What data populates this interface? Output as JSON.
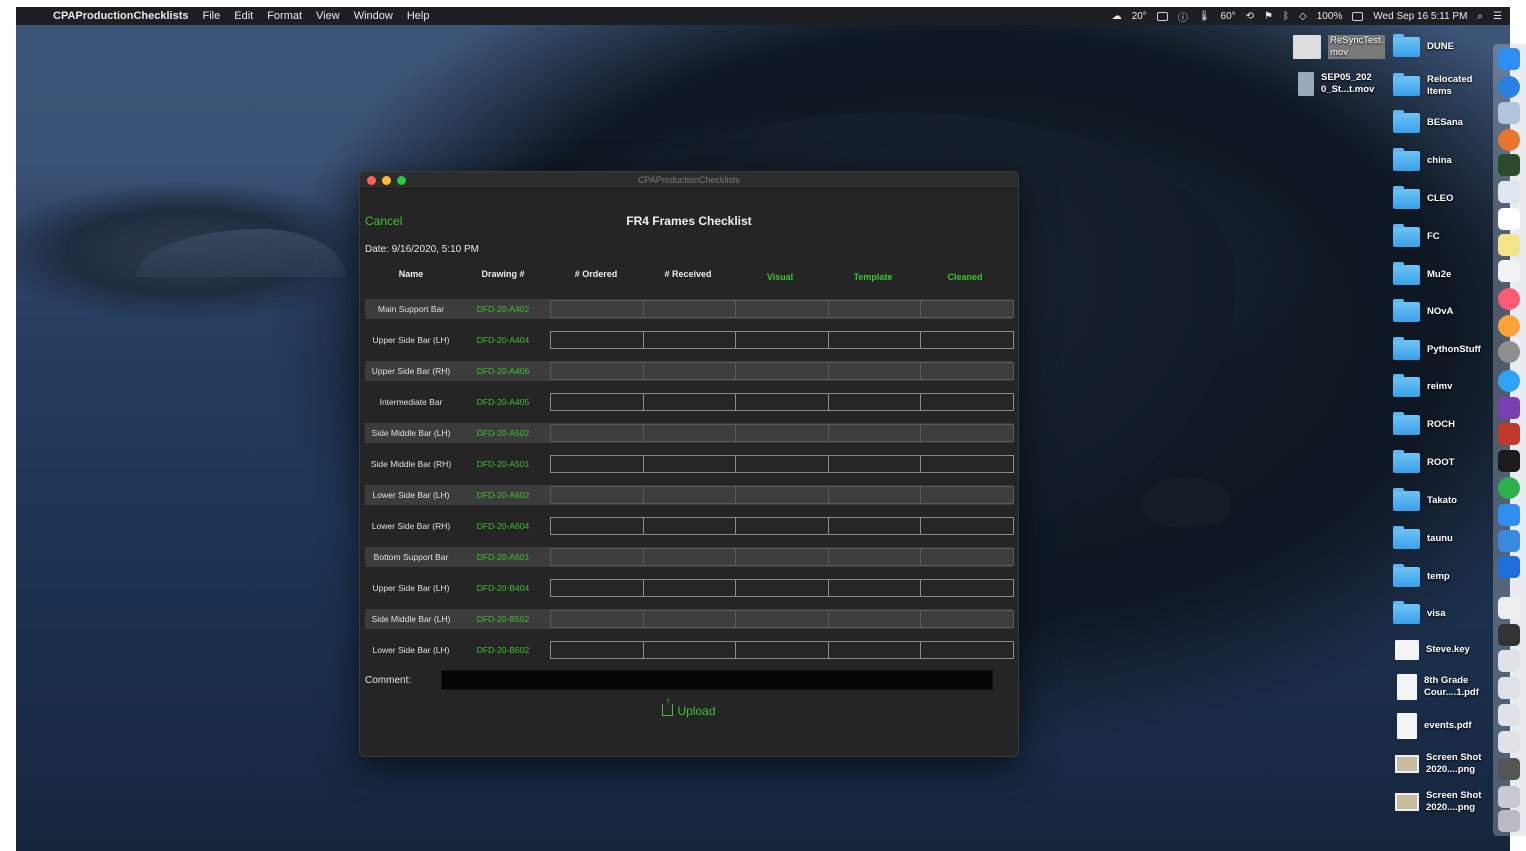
{
  "menubar": {
    "app_name": "CPAProductionChecklists",
    "menus": [
      "File",
      "Edit",
      "Format",
      "View",
      "Window",
      "Help"
    ],
    "status": {
      "weather": "20°",
      "temp": "60°",
      "battery": "100%",
      "datetime": "Wed Sep 16  5:11 PM"
    }
  },
  "desktop_icons": [
    {
      "label": "ReSyncTest.\nmov",
      "kind": "doc"
    },
    {
      "label": "SEP05_202\n0_St...t.mov",
      "kind": "doc"
    },
    {
      "label": "DUNE",
      "kind": "folder"
    },
    {
      "label": "Relocated\nItems",
      "kind": "folder"
    },
    {
      "label": "BESana",
      "kind": "folder"
    },
    {
      "label": "china",
      "kind": "folder"
    },
    {
      "label": "CLEO",
      "kind": "folder"
    },
    {
      "label": "FC",
      "kind": "folder"
    },
    {
      "label": "Mu2e",
      "kind": "folder"
    },
    {
      "label": "NOvA",
      "kind": "folder"
    },
    {
      "label": "PythonStuff",
      "kind": "folder"
    },
    {
      "label": "reimv",
      "kind": "folder"
    },
    {
      "label": "ROCH",
      "kind": "folder"
    },
    {
      "label": "ROOT",
      "kind": "folder"
    },
    {
      "label": "Takato",
      "kind": "folder"
    },
    {
      "label": "taunu",
      "kind": "folder"
    },
    {
      "label": "temp",
      "kind": "folder"
    },
    {
      "label": "visa",
      "kind": "folder"
    },
    {
      "label": "Steve.key",
      "kind": "doc"
    },
    {
      "label": "8th Grade\nCour....1.pdf",
      "kind": "doc"
    },
    {
      "label": "events.pdf",
      "kind": "doc"
    },
    {
      "label": "Screen Shot\n2020....png",
      "kind": "shot"
    },
    {
      "label": "Screen Shot\n2020....png",
      "kind": "shot"
    }
  ],
  "window": {
    "title": "CPAProductionChecklists",
    "cancel_label": "Cancel",
    "sheet_title": "FR4 Frames Checklist",
    "date_label": "Date:  9/16/2020,  5:10 PM",
    "columns": {
      "name": "Name",
      "drawing": "Drawing #",
      "ordered": "# Ordered",
      "received": "# Received",
      "visual": "Visual",
      "template": "Template",
      "cleaned": "Cleaned"
    },
    "rows": [
      {
        "name": "Main Support Bar",
        "drawing": "DFD-20-A402"
      },
      {
        "name": "Upper Side Bar (LH)",
        "drawing": "DFD-20-A404"
      },
      {
        "name": "Upper Side Bar (RH)",
        "drawing": "DFD-20-A406"
      },
      {
        "name": "Intermediate Bar",
        "drawing": "DFD-20-A405"
      },
      {
        "name": "Side Middle Bar (LH)",
        "drawing": "DFD-20-A502"
      },
      {
        "name": "Side Middle Bar (RH)",
        "drawing": "DFD-20-A501"
      },
      {
        "name": "Lower Side Bar (LH)",
        "drawing": "DFD-20-A602"
      },
      {
        "name": "Lower Side Bar (RH)",
        "drawing": "DFD-20-A604"
      },
      {
        "name": "Bottom Support Bar",
        "drawing": "DFD-20-A601"
      },
      {
        "name": "Upper Side Bar (LH)",
        "drawing": "DFD-20-B404"
      },
      {
        "name": "Side Middle Bar (LH)",
        "drawing": "DFD-20-B502"
      },
      {
        "name": "Lower Side Bar (LH)",
        "drawing": "DFD-20-B602"
      }
    ],
    "comment_label": "Comment:",
    "comment_value": "",
    "upload_label": "Upload"
  },
  "colors": {
    "accent_green": "#3ec22e",
    "window_bg": "#252525"
  }
}
